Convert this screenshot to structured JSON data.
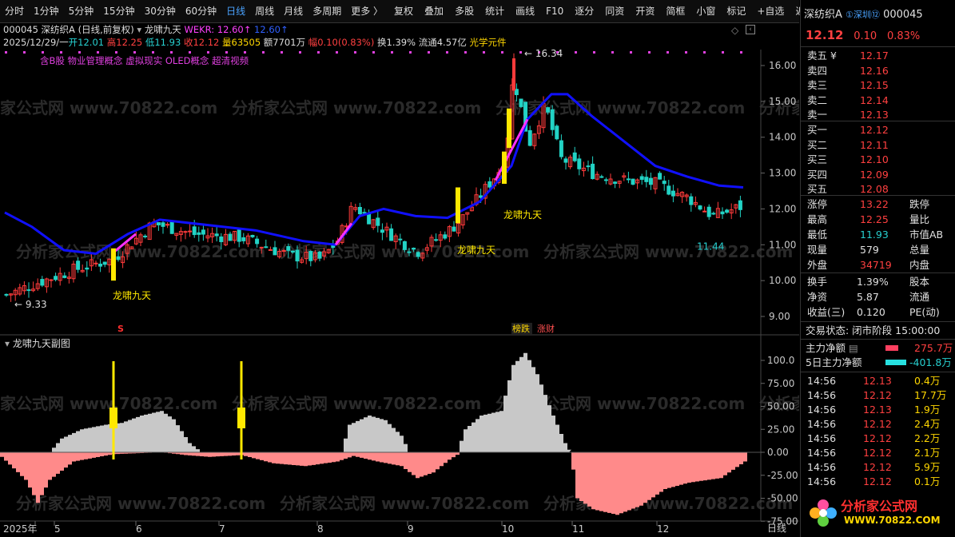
{
  "toolbar": {
    "items": [
      "分时",
      "1分钟",
      "5分钟",
      "15分钟",
      "30分钟",
      "60分钟",
      "日线",
      "周线",
      "月线",
      "多周期",
      "更多 〉",
      "复权",
      "叠加",
      "多股",
      "统计",
      "画线",
      "F10",
      "逐分",
      "同资",
      "开资",
      "简框",
      "小窗",
      "标记",
      "+自选",
      "返回"
    ],
    "active": "日线"
  },
  "header": {
    "code_name": "000045 深纺织A (日线,前复权)",
    "indicator_name": "龙啸九天",
    "wekr_label": "WEKR: 12.60↑",
    "wekr2_label": "12.60↑",
    "date": "2025/12/29/一",
    "open": "开12.01",
    "high": "高12.25",
    "low": "低11.93",
    "close": "收12.12",
    "volume": "量63505",
    "amount": "额7701万",
    "change": "幅0.10(0.83%)",
    "turnover": "换1.39%",
    "float": "流通4.57亿",
    "concept": "光学元件",
    "tags": "含B股 物业管理概念 虚拟现实 OLED概念 超清视频"
  },
  "main_chart": {
    "y_ticks": [
      "16.00",
      "15.00",
      "14.00",
      "13.00",
      "12.00",
      "11.00",
      "10.00",
      "9.00"
    ],
    "high_label": "16.34",
    "low_label": "9.33",
    "low2_label": "11.44",
    "signal_labels": [
      "龙啸九天",
      "龙啸九天",
      "龙啸九天"
    ],
    "marker_s": "S",
    "marker_bang": "榜跌",
    "marker_cai": "涨财",
    "watermark": "分析家公式网 www.70822.com"
  },
  "sub_chart": {
    "title": "龙啸九天副图",
    "y_ticks": [
      "100.0",
      "75.00",
      "50.00",
      "25.00",
      "0.00",
      "-25.00",
      "-50.00",
      "-75.00"
    ]
  },
  "x_axis": {
    "labels": [
      "2025年",
      "5",
      "6",
      "7",
      "8",
      "9",
      "10",
      "11",
      "12"
    ],
    "period": "日线"
  },
  "right_panel": {
    "name": "深纺织A",
    "market": "①深圳",
    "badge": "⑫",
    "code": "000045",
    "price": "12.12",
    "change": "0.10",
    "change_pct": "0.83%",
    "asks": [
      {
        "label": "卖五 ¥",
        "price": "12.17",
        "vol": ""
      },
      {
        "label": "卖四",
        "price": "12.16",
        "vol": ""
      },
      {
        "label": "卖三",
        "price": "12.15",
        "vol": ""
      },
      {
        "label": "卖二",
        "price": "12.14",
        "vol": ""
      },
      {
        "label": "卖一",
        "price": "12.13",
        "vol": ""
      }
    ],
    "bids": [
      {
        "label": "买一",
        "price": "12.12"
      },
      {
        "label": "买二",
        "price": "12.11"
      },
      {
        "label": "买三",
        "price": "12.10"
      },
      {
        "label": "买四",
        "price": "12.09"
      },
      {
        "label": "买五",
        "price": "12.08"
      }
    ],
    "stats1": [
      {
        "k": "涨停",
        "v": "13.22",
        "k2": "跌停"
      },
      {
        "k": "最高",
        "v": "12.25",
        "k2": "量比"
      },
      {
        "k": "最低",
        "v": "11.93",
        "k2": "市值AB"
      },
      {
        "k": "现量",
        "v": "579",
        "k2": "总量"
      },
      {
        "k": "外盘",
        "v": "34719",
        "k2": "内盘"
      }
    ],
    "stats2": [
      {
        "k": "换手",
        "v": "1.39%",
        "k2": "股本"
      },
      {
        "k": "净资",
        "v": "5.87",
        "k2": "流通"
      },
      {
        "k": "收益(三)",
        "v": "0.120",
        "k2": "PE(动)"
      }
    ],
    "trade_status": "交易状态: 闭市阶段 15:00:00",
    "main_flow_label": "主力净额",
    "main_flow_value": "275.7万",
    "flow5_label": "5日主力净额",
    "flow5_value": "-401.8万",
    "ticks": [
      {
        "t": "14:56",
        "p": "12.13",
        "v": "0.4万"
      },
      {
        "t": "14:56",
        "p": "12.12",
        "v": "17.7万"
      },
      {
        "t": "14:56",
        "p": "12.13",
        "v": "1.9万"
      },
      {
        "t": "14:56",
        "p": "12.12",
        "v": "2.4万"
      },
      {
        "t": "14:56",
        "p": "12.12",
        "v": "2.2万"
      },
      {
        "t": "14:56",
        "p": "12.12",
        "v": "2.1万"
      },
      {
        "t": "14:56",
        "p": "12.12",
        "v": "5.9万"
      },
      {
        "t": "14:56",
        "p": "12.12",
        "v": "0.1万"
      }
    ],
    "logo_text": "分析家公式网",
    "logo_url": "WWW.70822.COM"
  }
}
